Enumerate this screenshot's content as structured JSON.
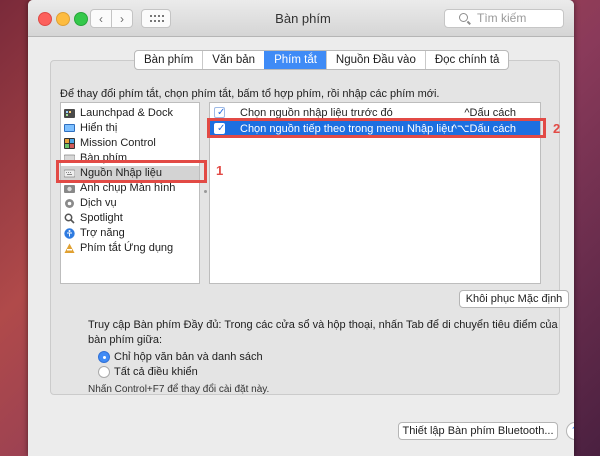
{
  "window": {
    "title": "Bàn phím"
  },
  "toolbar": {
    "back_glyph": "‹",
    "forward_glyph": "›"
  },
  "search": {
    "placeholder": "Tìm kiếm"
  },
  "tabs": [
    {
      "label": "Bàn phím",
      "active": false
    },
    {
      "label": "Văn bản",
      "active": false
    },
    {
      "label": "Phím tắt",
      "active": true
    },
    {
      "label": "Nguồn Đầu vào",
      "active": false
    },
    {
      "label": "Đọc chính tả",
      "active": false
    }
  ],
  "instructions": "Để thay đổi phím tắt, chọn phím tắt, bấm tổ hợp phím, rồi nhập các phím mới.",
  "categories": [
    {
      "label": "Launchpad & Dock",
      "icon": "launchpad-icon"
    },
    {
      "label": "Hiển thị",
      "icon": "display-icon"
    },
    {
      "label": "Mission Control",
      "icon": "mission-control-icon"
    },
    {
      "label": "Bàn phím",
      "icon": "keyboard-icon"
    },
    {
      "label": "Nguồn Nhập liệu",
      "icon": "input-source-icon",
      "selected": true
    },
    {
      "label": "Ảnh chụp Màn hình",
      "icon": "screenshot-icon"
    },
    {
      "label": "Dịch vụ",
      "icon": "services-gear-icon"
    },
    {
      "label": "Spotlight",
      "icon": "spotlight-icon"
    },
    {
      "label": "Trợ năng",
      "icon": "accessibility-icon"
    },
    {
      "label": "Phím tắt Ứng dụng",
      "icon": "app-shortcuts-icon"
    }
  ],
  "shortcuts": [
    {
      "label": "Chọn nguồn nhập liệu trước đó",
      "keys": "^Dấu cách",
      "checked": true,
      "selected": false
    },
    {
      "label": "Chọn nguồn tiếp theo trong menu Nhập liệu",
      "keys": "^⌥Dấu cách",
      "checked": true,
      "selected": true
    }
  ],
  "annotations": {
    "one": "1",
    "two": "2"
  },
  "restore_button": "Khôi phục Mặc định",
  "full_access": {
    "text": "Truy cập Bàn phím Đầy đủ: Trong các cửa sổ và hộp thoại, nhấn Tab để di chuyển tiêu điểm của bàn phím giữa:",
    "options": [
      {
        "label": "Chỉ hộp văn bản và danh sách",
        "selected": true
      },
      {
        "label": "Tất cả điều khiển",
        "selected": false
      }
    ],
    "hint": "Nhấn Control+F7 để thay đổi cài đặt này."
  },
  "bluetooth_button": "Thiết lập Bàn phím Bluetooth...",
  "help_glyph": "?",
  "colors": {
    "accent": "#3f8bf6",
    "selection": "#1d6fe0",
    "annotation": "#e24a45"
  }
}
